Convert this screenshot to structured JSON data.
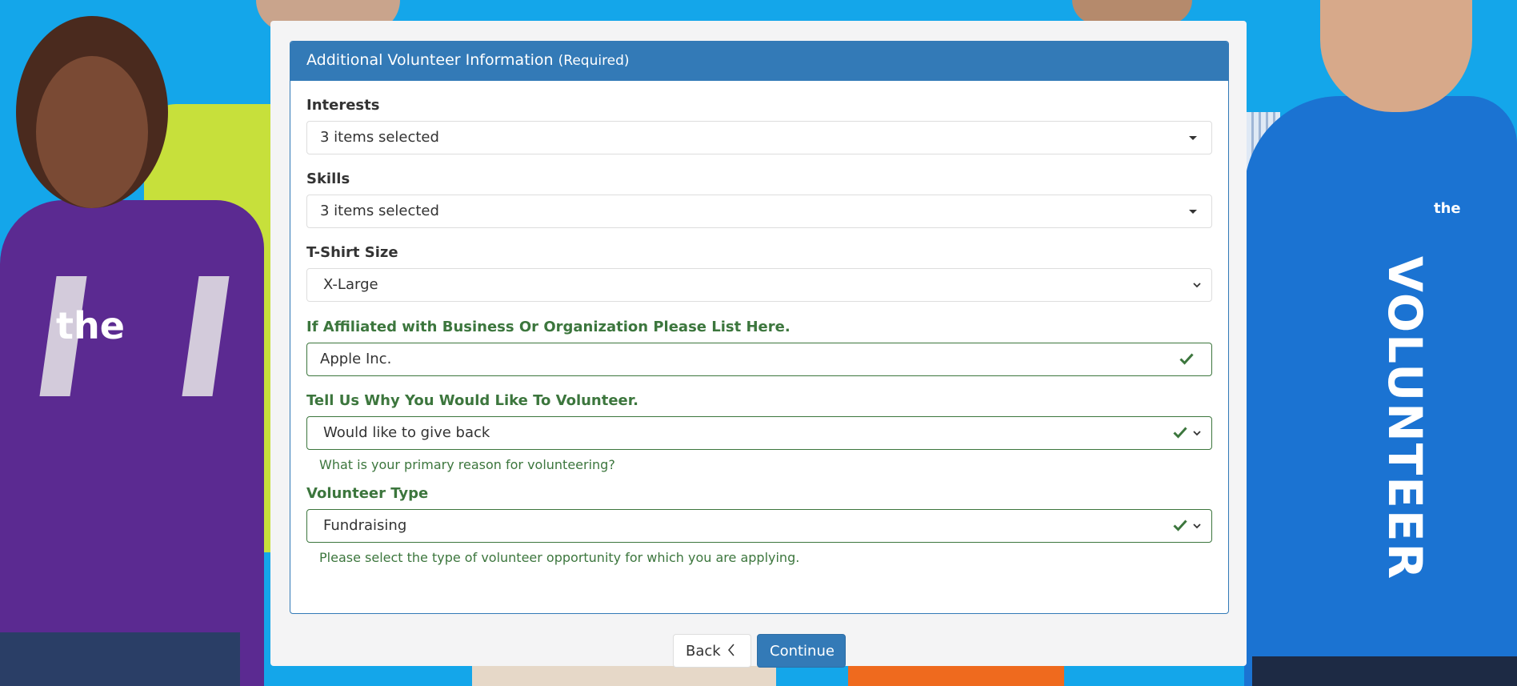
{
  "panel": {
    "title": "Additional Volunteer Information",
    "title_suffix": "(Required)"
  },
  "fields": {
    "interests": {
      "label": "Interests",
      "value": "3 items selected"
    },
    "skills": {
      "label": "Skills",
      "value": "3 items selected"
    },
    "tshirt": {
      "label": "T-Shirt Size",
      "value": "X-Large"
    },
    "affiliation": {
      "label": "If Affiliated with Business Or Organization Please List Here.",
      "value": "Apple Inc."
    },
    "reason": {
      "label": "Tell Us Why You Would Like To Volunteer.",
      "value": "Would like to give back",
      "help": "What is your primary reason for volunteering?"
    },
    "volunteer_type": {
      "label": "Volunteer Type",
      "value": "Fundraising",
      "help": "Please select the type of volunteer opportunity for which you are applying."
    }
  },
  "buttons": {
    "back": "Back",
    "continue": "Continue"
  },
  "background": {
    "logo_text_left": "the",
    "logo_text_right": "the",
    "shirt_text": "VOLUNTEER"
  },
  "colors": {
    "primary": "#337ab7",
    "success": "#3c763d",
    "background": "#14a6ea"
  }
}
